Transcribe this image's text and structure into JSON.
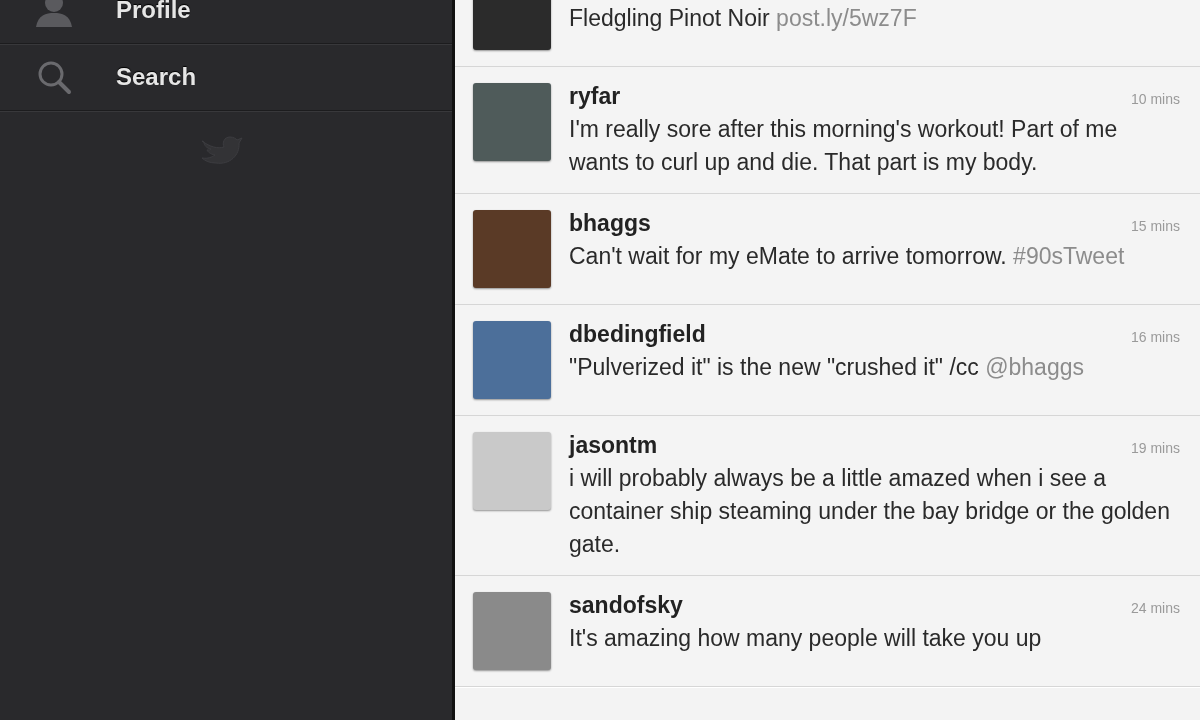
{
  "sidebar": {
    "items": [
      {
        "kind": "profile",
        "label": "Profile"
      },
      {
        "kind": "search",
        "label": "Search"
      }
    ]
  },
  "timeline": {
    "tweets": [
      {
        "text": "Fledgling Pinot Noir ",
        "link": "post.ly/5wz7F"
      },
      {
        "user": "ryfar",
        "time": "10 mins",
        "text": "I'm really sore after this morning's workout! Part of me wants to curl up and die. That part is my body."
      },
      {
        "user": "bhaggs",
        "time": "15 mins",
        "text": "Can't wait for my eMate to arrive tomorrow. ",
        "link": "#90sTweet"
      },
      {
        "user": "dbedingfield",
        "time": "16 mins",
        "text": "\"Pulverized it\" is the new \"crushed it\" /cc ",
        "link": "@bhaggs"
      },
      {
        "user": "jasontm",
        "time": "19 mins",
        "text": "i will probably always be a little amazed when i see a container ship steaming under the bay bridge or the golden gate."
      },
      {
        "user": "sandofsky",
        "time": "24 mins",
        "text": "It's amazing how many people will take you up"
      }
    ]
  }
}
